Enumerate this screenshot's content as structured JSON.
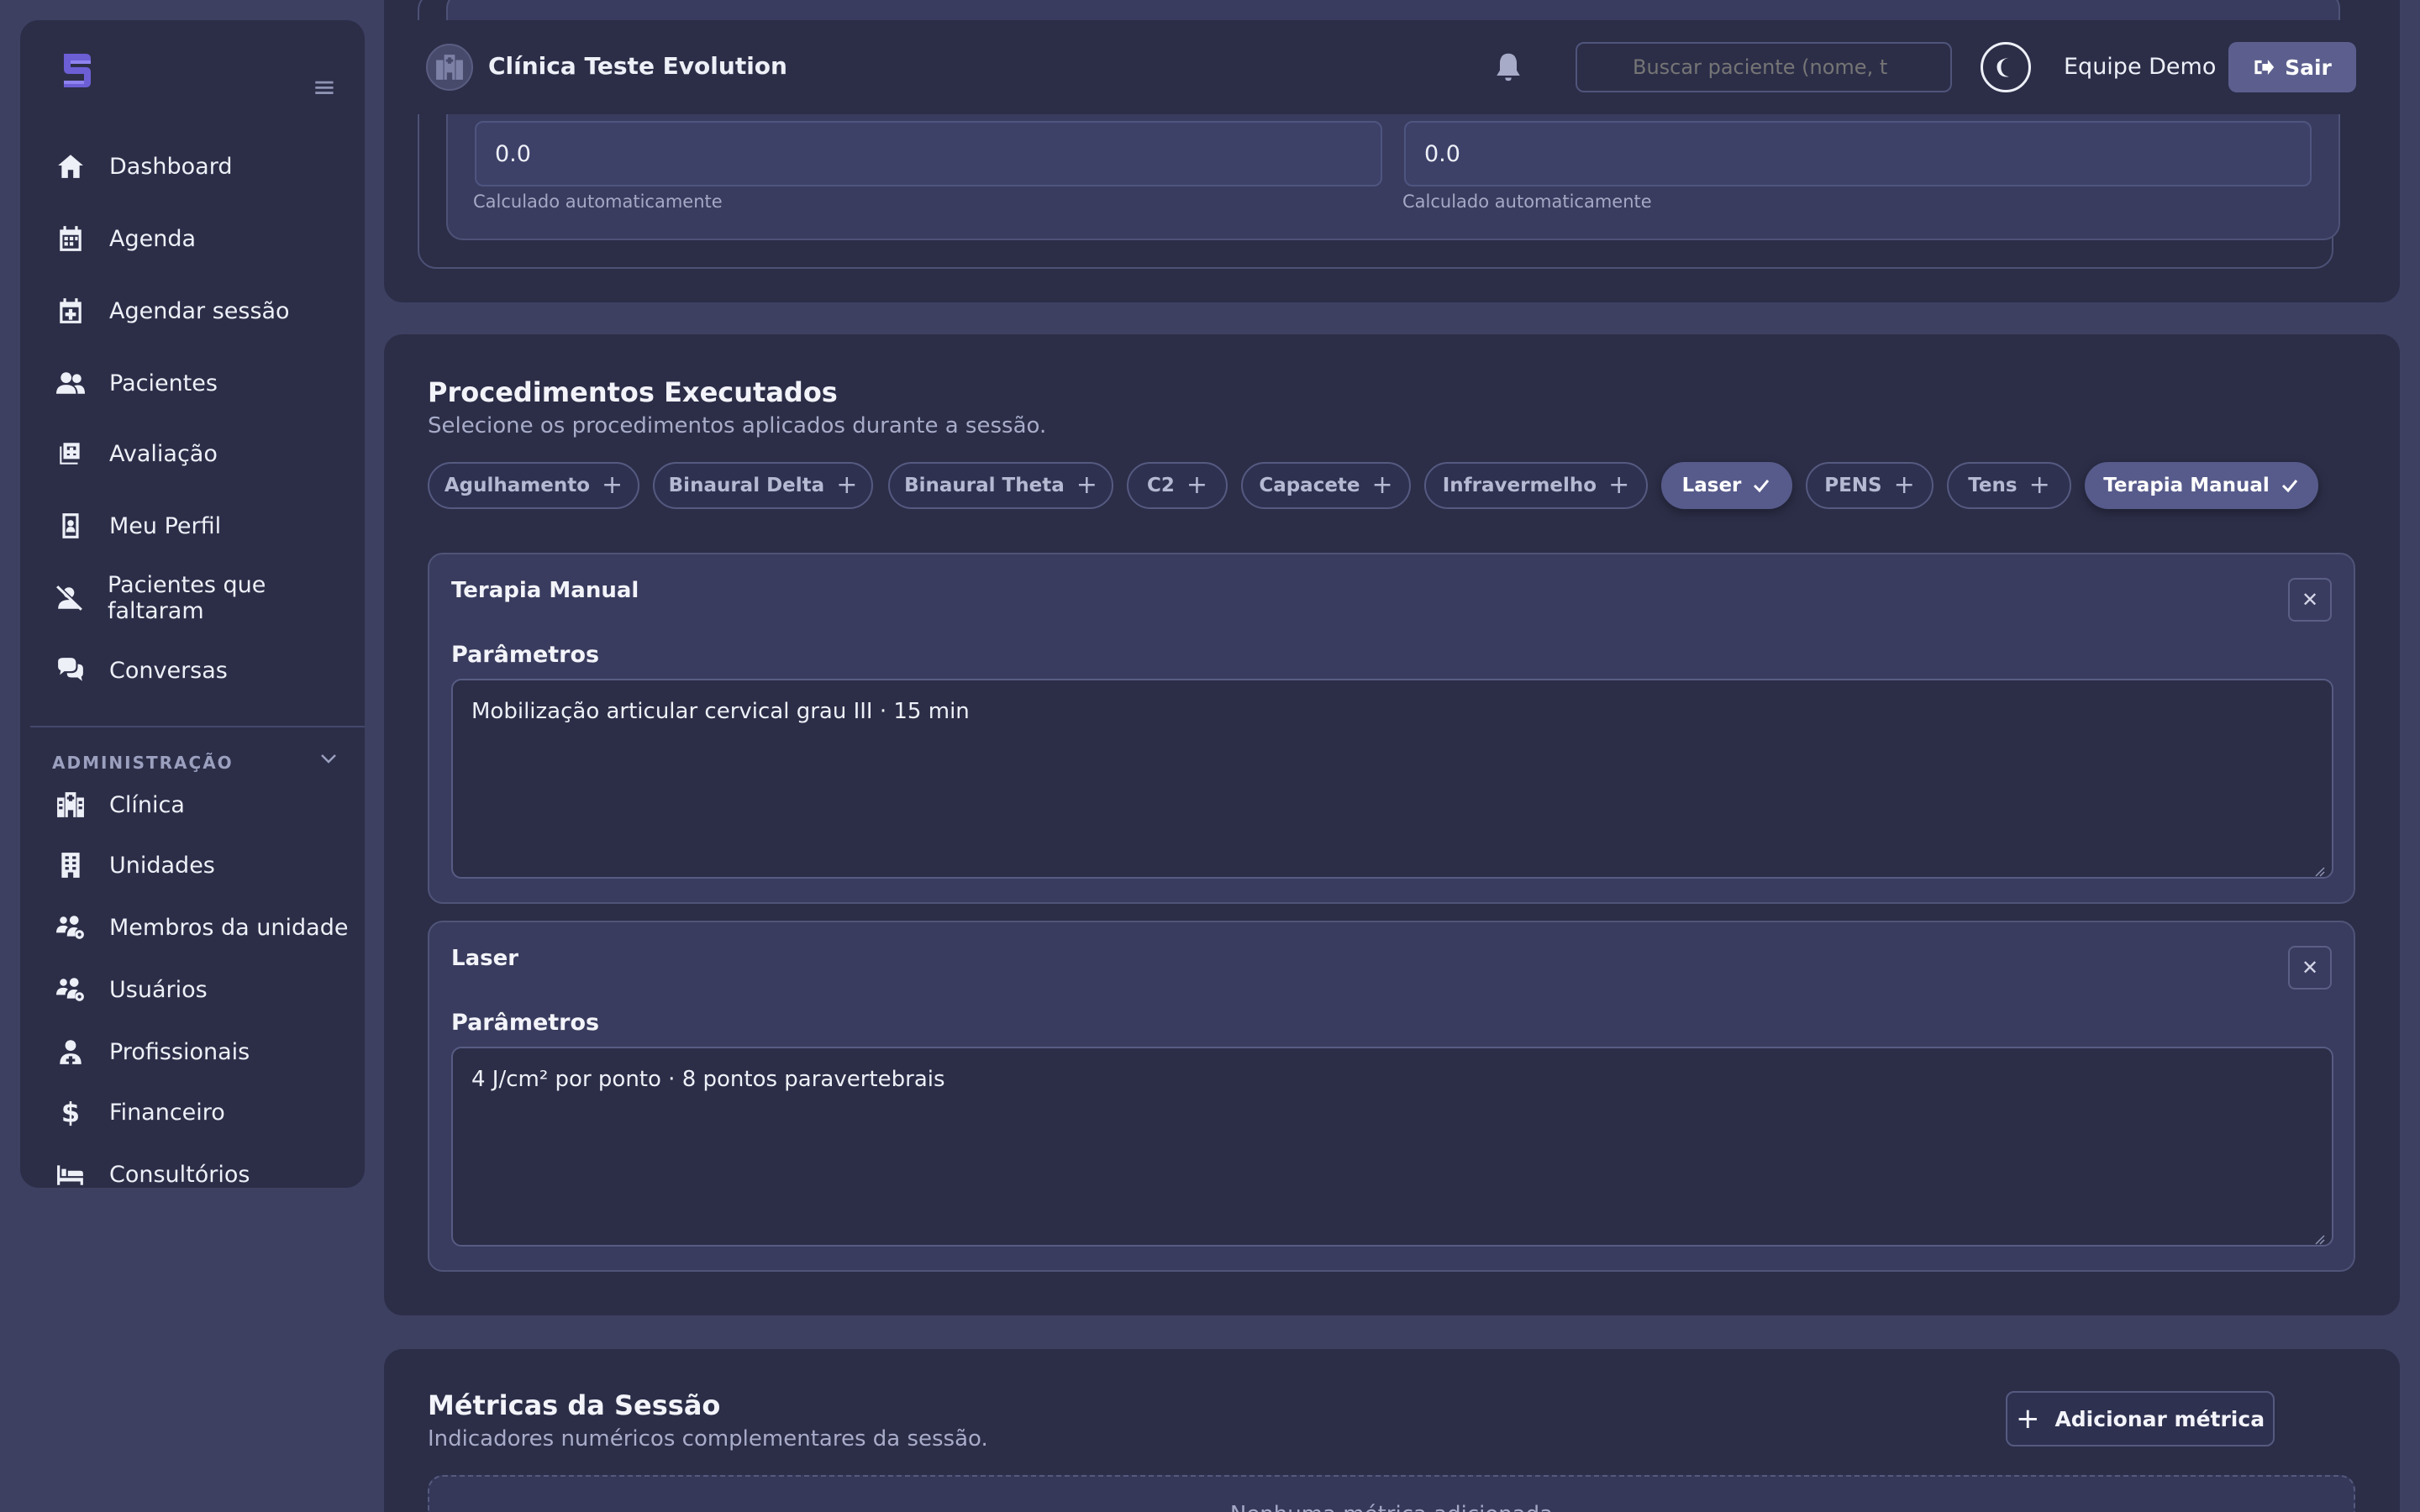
{
  "topbar": {
    "clinic_name": "Clínica Teste Evolution",
    "search_placeholder": "Buscar paciente (nome, t",
    "user_name": "Equipe Demo",
    "exit_label": "Sair"
  },
  "sidebar": {
    "items": [
      {
        "label": "Dashboard",
        "icon": "home-icon"
      },
      {
        "label": "Agenda",
        "icon": "calendar-icon"
      },
      {
        "label": "Agendar sessão",
        "icon": "calendar-plus-icon"
      },
      {
        "label": "Pacientes",
        "icon": "users-icon"
      },
      {
        "label": "Avaliação",
        "icon": "clipboard-plus-icon"
      },
      {
        "label": "Meu Perfil",
        "icon": "id-badge-icon"
      },
      {
        "label": "Pacientes que faltaram",
        "icon": "user-slash-icon"
      },
      {
        "label": "Conversas",
        "icon": "comments-icon"
      }
    ],
    "admin_section": "ADMINISTRAÇÃO",
    "admin_items": [
      {
        "label": "Clínica",
        "icon": "hospital-icon"
      },
      {
        "label": "Unidades",
        "icon": "building-icon"
      },
      {
        "label": "Membros da unidade",
        "icon": "users-cog-icon"
      },
      {
        "label": "Usuários",
        "icon": "users-cog-icon"
      },
      {
        "label": "Profissionais",
        "icon": "user-doctor-icon"
      },
      {
        "label": "Financeiro",
        "icon": "dollar-icon"
      },
      {
        "label": "Consultórios",
        "icon": "bed-icon"
      }
    ]
  },
  "calculated": {
    "value_left": "0.0",
    "value_right": "0.0",
    "hint": "Calculado automaticamente"
  },
  "procedures": {
    "title": "Procedimentos Executados",
    "subtitle": "Selecione os procedimentos aplicados durante a sessão.",
    "chips": [
      {
        "label": "Agulhamento",
        "selected": false
      },
      {
        "label": "Binaural Delta",
        "selected": false
      },
      {
        "label": "Binaural Theta",
        "selected": false
      },
      {
        "label": "C2",
        "selected": false
      },
      {
        "label": "Capacete",
        "selected": false
      },
      {
        "label": "Infravermelho",
        "selected": false
      },
      {
        "label": "Laser",
        "selected": true
      },
      {
        "label": "PENS",
        "selected": false
      },
      {
        "label": "Tens",
        "selected": false
      },
      {
        "label": "Terapia Manual",
        "selected": true
      }
    ],
    "params_label": "Parâmetros",
    "selected_items": [
      {
        "name": "Terapia Manual",
        "params": "Mobilização articular cervical grau III · 15 min"
      },
      {
        "name": "Laser",
        "params": "4 J/cm² por ponto · 8 pontos paravertebrais"
      }
    ]
  },
  "metrics": {
    "title": "Métricas da Sessão",
    "subtitle": "Indicadores numéricos complementares da sessão.",
    "add_label": "Adicionar métrica",
    "empty_text": "Nenhuma métrica adicionada"
  }
}
